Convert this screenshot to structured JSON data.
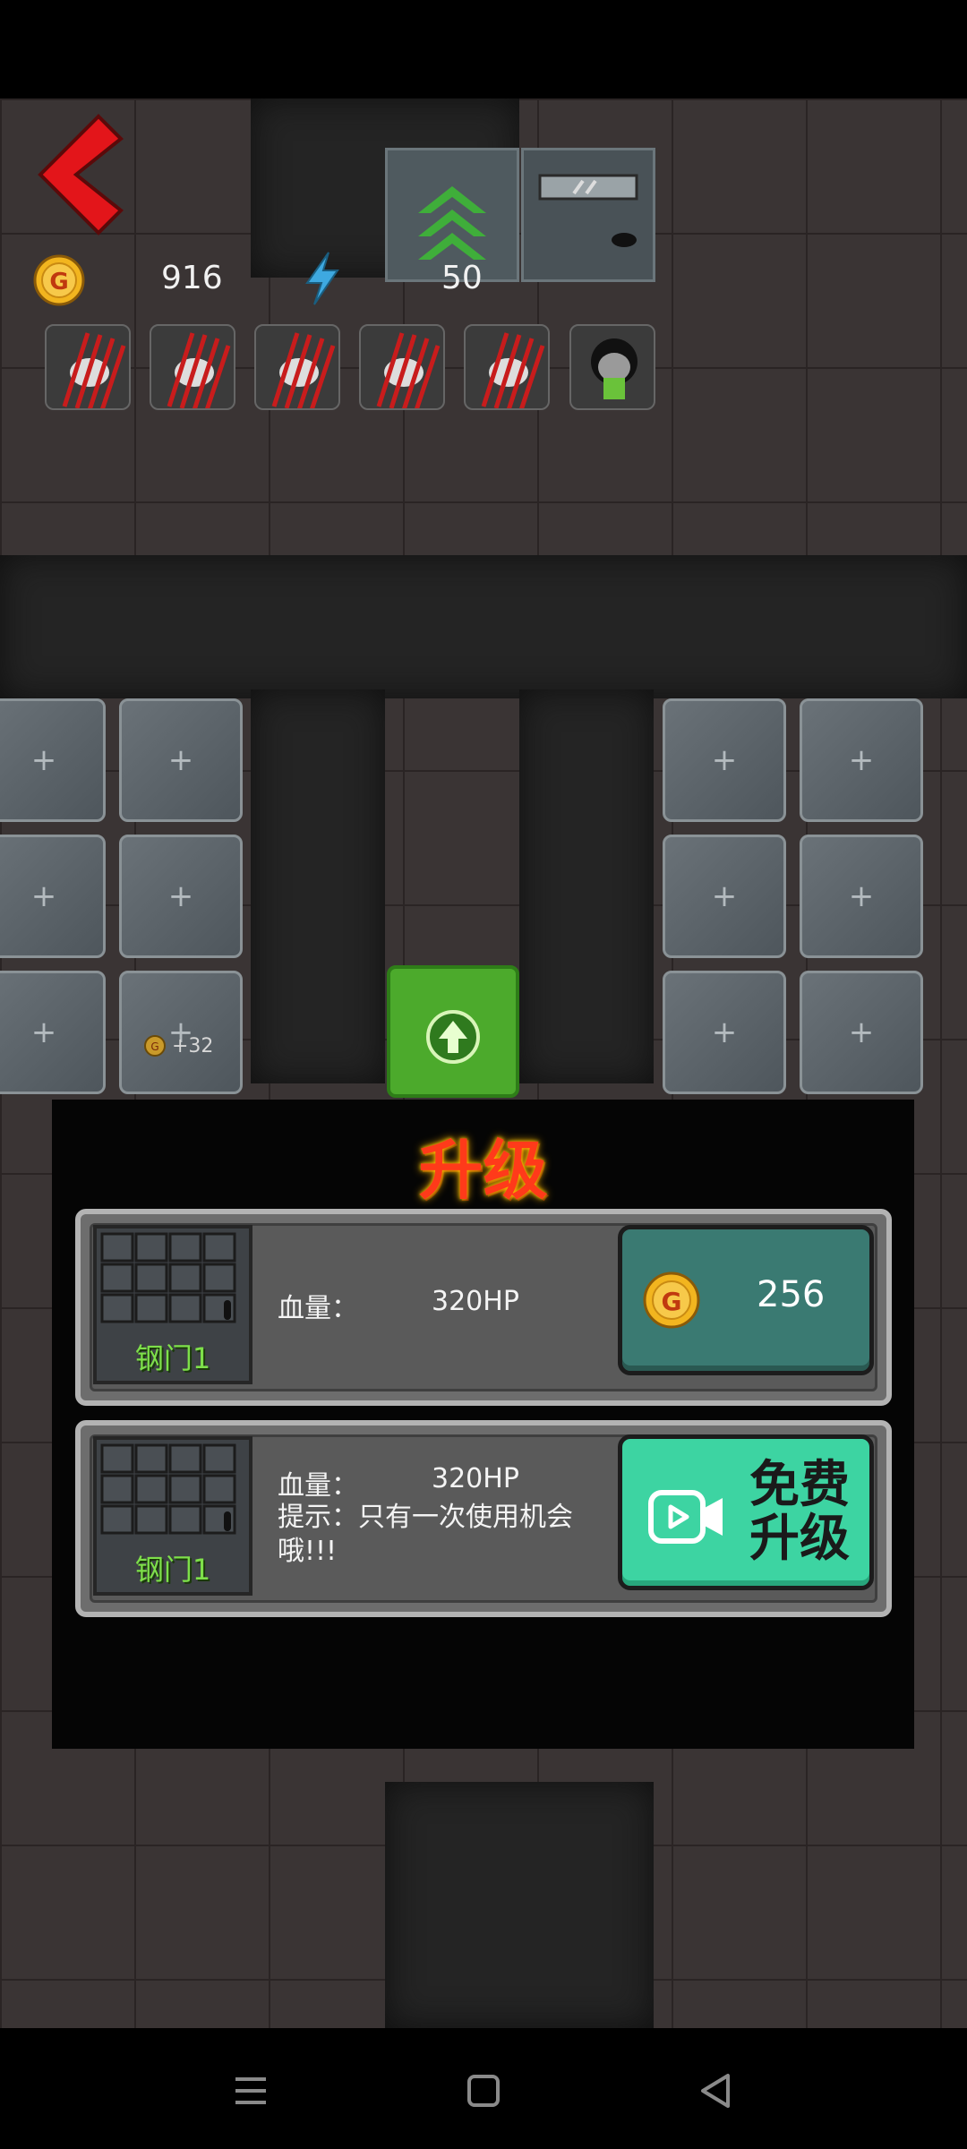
{
  "hud": {
    "coins": "916",
    "energy": "50"
  },
  "floating_reward": "+32",
  "upgrade_dialog": {
    "title": "升级",
    "paid_option": {
      "item_name": "钢门1",
      "hp_label": "血量：",
      "hp_value": "320HP",
      "price": "256"
    },
    "free_option": {
      "item_name": "钢门1",
      "hp_label": "血量：",
      "hp_value": "320HP",
      "hint": "提示：只有一次使用机会哦!!!",
      "button_label": "免费\n升级"
    }
  },
  "colors": {
    "accent_red": "#e3151a",
    "coin_gold": "#f2b51f",
    "free_button": "#3dd4a2",
    "price_button": "#3a7a72",
    "door_label_green": "#7ee04a"
  }
}
